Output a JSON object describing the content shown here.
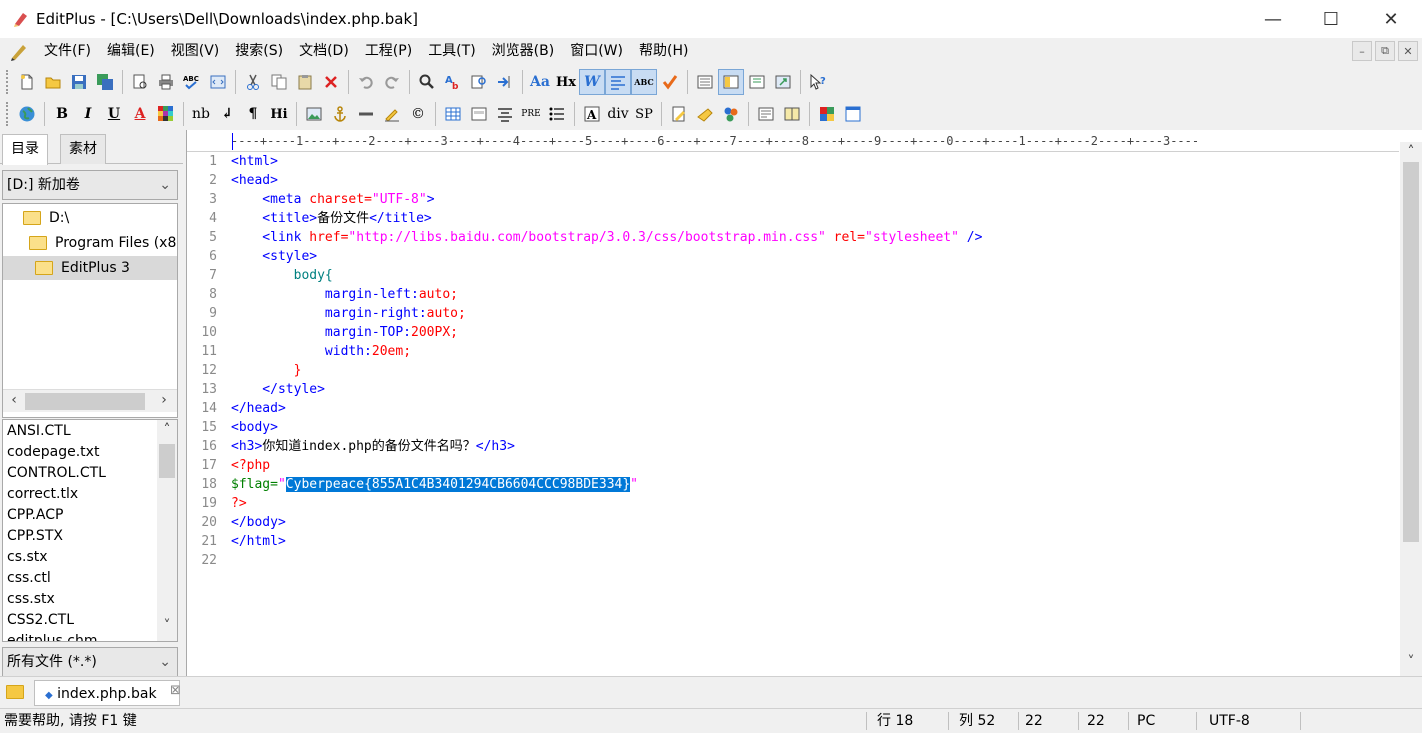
{
  "window": {
    "title": "EditPlus - [C:\\Users\\Dell\\Downloads\\index.php.bak]",
    "minimize": "—",
    "maximize": "☐",
    "close": "✕"
  },
  "menu": {
    "items": [
      "文件(F)",
      "编辑(E)",
      "视图(V)",
      "搜索(S)",
      "文档(D)",
      "工程(P)",
      "工具(T)",
      "浏览器(B)",
      "窗口(W)",
      "帮助(H)"
    ],
    "mdi_min": "–",
    "mdi_restore": "⧉",
    "mdi_close": "✕"
  },
  "toolbar2": {
    "bold": "B",
    "italic": "I",
    "underline": "U",
    "font_color": "A",
    "nbsp": "nb",
    "newline": "↲",
    "paragraph": "¶",
    "heading": "Hi",
    "pre": "PRE",
    "div": "div",
    "span": "SP",
    "copyright": "©"
  },
  "toolbar1": {
    "font": "Aa",
    "hx": "Hx",
    "wrap": "W",
    "spell": "ABC"
  },
  "sidebar": {
    "tabs": [
      "目录",
      "素材"
    ],
    "drive": "[D:] 新加卷",
    "dirs": [
      {
        "label": "D:\\"
      },
      {
        "label": "Program Files (x8"
      },
      {
        "label": "EditPlus 3"
      }
    ],
    "files": [
      "ANSI.CTL",
      "codepage.txt",
      "CONTROL.CTL",
      "correct.tlx",
      "CPP.ACP",
      "CPP.STX",
      "cs.stx",
      "css.ctl",
      "css.stx",
      "CSS2.CTL",
      "editplus.chm"
    ],
    "filter": "所有文件 (*.*)"
  },
  "editor": {
    "ruler": "----+----1----+----2----+----3----+----4----+----5----+----6----+----7----+----8----+----9----+----0----+----1----+----2----+----3----",
    "line_numbers": [
      "1",
      "2",
      "3",
      "4",
      "5",
      "6",
      "7",
      "8",
      "9",
      "10",
      "11",
      "12",
      "13",
      "14",
      "15",
      "16",
      "17",
      "18",
      "19",
      "20",
      "21",
      "22"
    ],
    "code": {
      "l1": "<html>",
      "l2": "<head>",
      "l3_open": "    <meta ",
      "l3_attr": "charset=",
      "l3_str": "\"UTF-8\"",
      "l3_close": ">",
      "l4_open": "    <title>",
      "l4_text": "备份文件",
      "l4_close": "</title>",
      "l5_open": "    <link ",
      "l5_attr1": "href=",
      "l5_str1": "\"http://libs.baidu.com/bootstrap/3.0.3/css/bootstrap.min.css\"",
      "l5_attr2": " rel=",
      "l5_str2": "\"stylesheet\"",
      "l5_close": " />",
      "l6": "    <style>",
      "l7": "        body{",
      "l8_prop": "            margin-left:",
      "l8_val": "auto;",
      "l9_prop": "            margin-right:",
      "l9_val": "auto;",
      "l10_prop": "            margin-TOP:",
      "l10_val": "200PX;",
      "l11_prop": "            width:",
      "l11_val": "20em;",
      "l12": "        }",
      "l13": "    </style>",
      "l14": "</head>",
      "l15": "<body>",
      "l16_open": "<h3>",
      "l16_text": "你知道index.php的备份文件名吗？",
      "l16_close": "</h3>",
      "l17": "<?php",
      "l18_var": "$flag=",
      "l18_q1": "\"",
      "l18_flag": "Cyberpeace{855A1C4B3401294CB6604CCC98BDE334}",
      "l18_q2": "\"",
      "l19": "?>",
      "l20": "</body>",
      "l21": "</html>",
      "l22": ""
    }
  },
  "doc_tab": {
    "label": "index.php.bak",
    "close": "⊠"
  },
  "status": {
    "help": "需要帮助, 请按 F1 键",
    "line": "行 18",
    "col": "列 52",
    "v1": "22",
    "v2": "22",
    "mode": "PC",
    "encoding": "UTF-8"
  },
  "colors": {
    "tag": "#0000ff",
    "attribute": "#ff0000",
    "string": "#ff00ff",
    "selection": "#0078d7"
  }
}
